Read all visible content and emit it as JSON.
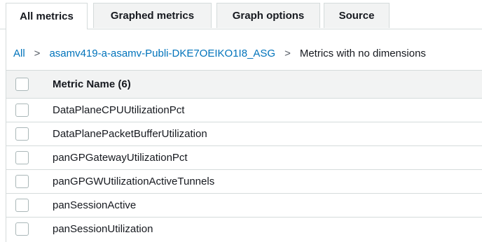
{
  "tabs": [
    {
      "label": "All metrics",
      "active": true
    },
    {
      "label": "Graphed metrics",
      "active": false
    },
    {
      "label": "Graph options",
      "active": false
    },
    {
      "label": "Source",
      "active": false
    }
  ],
  "breadcrumb": {
    "root": "All",
    "separator": ">",
    "namespace": "asamv419-a-asamv-Publi-DKE7OEIKO1I8_ASG",
    "current": "Metrics with no dimensions"
  },
  "table": {
    "header": "Metric Name (6)",
    "rows": [
      "DataPlaneCPUUtilizationPct",
      "DataPlanePacketBufferUtilization",
      "panGPGatewayUtilizationPct",
      "panGPGWUtilizationActiveTunnels",
      "panSessionActive",
      "panSessionUtilization"
    ]
  },
  "colors": {
    "link": "#0073bb",
    "border": "#d5dbdb",
    "header_bg": "#f2f3f3",
    "text": "#16191f"
  }
}
